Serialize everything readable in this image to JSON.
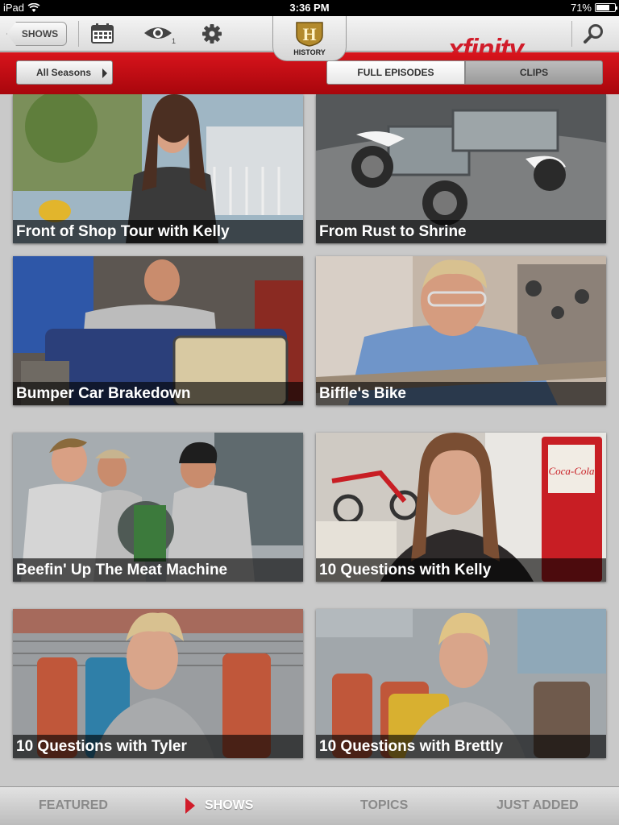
{
  "status": {
    "device": "iPad",
    "time": "3:36 PM",
    "battery": "71%",
    "battery_level": 0.71
  },
  "toolbar": {
    "back_label": "SHOWS",
    "watch_count": "1",
    "brand": "xfinity",
    "network_logo": "HISTORY"
  },
  "subbar": {
    "seasons_label": "All Seasons",
    "tab_full": "FULL EPISODES",
    "tab_clips": "CLIPS"
  },
  "clips": [
    {
      "title": "Front of Shop Tour with Kelly"
    },
    {
      "title": "From Rust to Shrine"
    },
    {
      "title": "Bumper Car Brakedown"
    },
    {
      "title": "Biffle's Bike"
    },
    {
      "title": "Beefin' Up The Meat Machine"
    },
    {
      "title": "10 Questions with Kelly"
    },
    {
      "title": "10 Questions with Tyler"
    },
    {
      "title": "10 Questions with Brettly"
    }
  ],
  "tabs": {
    "featured": "FEATURED",
    "shows": "SHOWS",
    "topics": "TOPICS",
    "just_added": "JUST ADDED"
  },
  "colors": {
    "accent": "#d11c2a",
    "redbar": "#c00d14"
  },
  "icons": [
    "wifi-icon",
    "calendar-icon",
    "eye-icon",
    "gear-icon",
    "search-icon",
    "play-arrow-icon"
  ]
}
